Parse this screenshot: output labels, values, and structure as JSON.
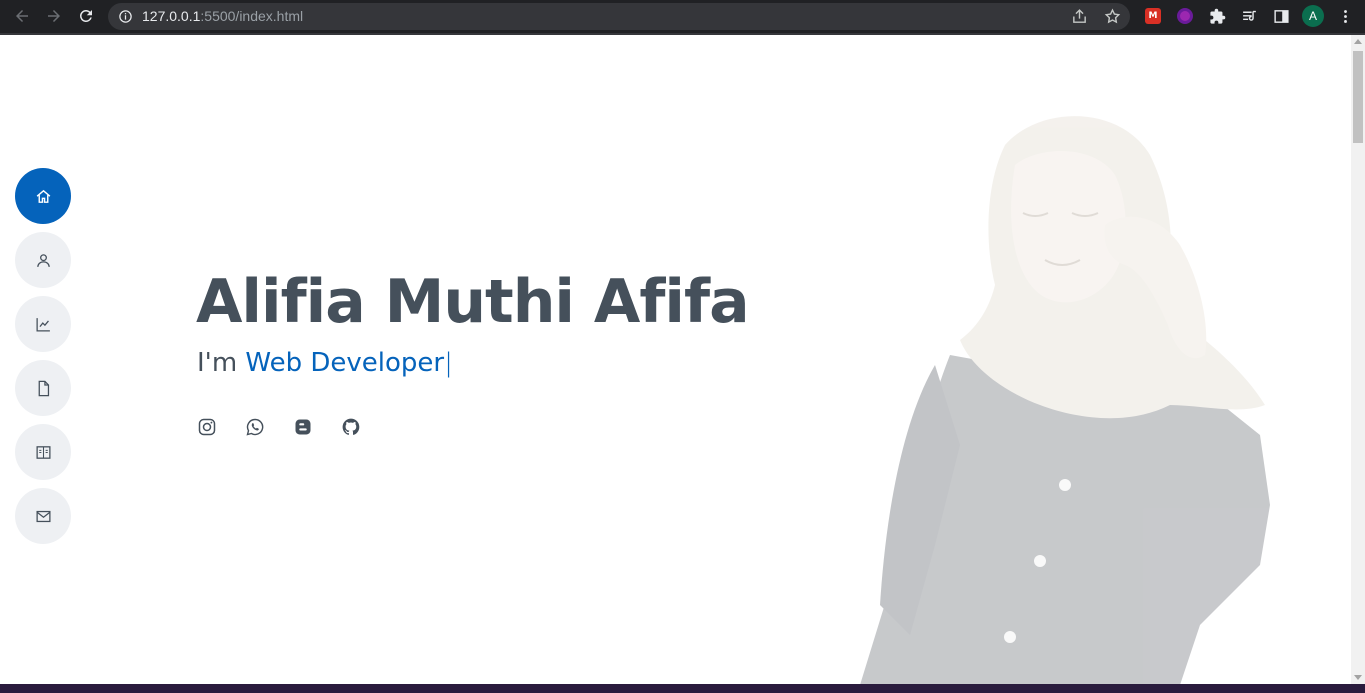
{
  "browser": {
    "url_host": "127.0.0.1",
    "url_rest": ":5500/index.html",
    "profile_initial": "A",
    "extensions": [
      "mendeley-extension-icon",
      "purple-circle-extension-icon",
      "puzzle-extensions-icon",
      "reading-list-icon",
      "side-panel-icon"
    ]
  },
  "nav": {
    "items": [
      {
        "name": "home",
        "icon": "home-icon",
        "active": true
      },
      {
        "name": "about",
        "icon": "person-icon",
        "active": false
      },
      {
        "name": "skills",
        "icon": "chart-icon",
        "active": false
      },
      {
        "name": "resume",
        "icon": "file-icon",
        "active": false
      },
      {
        "name": "portfolio",
        "icon": "book-icon",
        "active": false
      },
      {
        "name": "contact",
        "icon": "envelope-icon",
        "active": false
      }
    ]
  },
  "hero": {
    "name": "Alifia Muthi Afifa",
    "prefix": "I'm",
    "typed": "Web Developer",
    "cursor": "|",
    "socials": [
      "instagram-icon",
      "whatsapp-icon",
      "blogger-icon",
      "github-icon"
    ]
  },
  "colors": {
    "accent": "#0563bb",
    "text": "#45505b",
    "nav_bg": "#eef0f3"
  }
}
